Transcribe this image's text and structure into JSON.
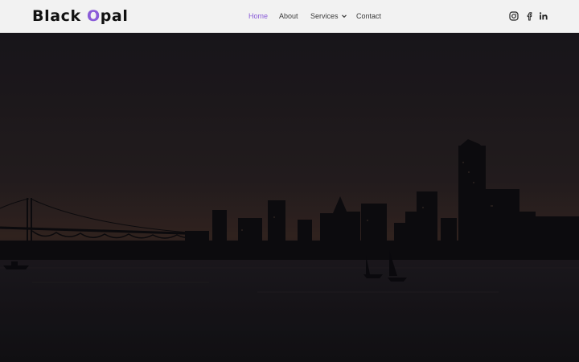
{
  "brand": {
    "name_prefix": "Black ",
    "name_accent": "O",
    "name_suffix": "pal",
    "accent_color": "#8a5cd8"
  },
  "nav": {
    "items": [
      {
        "label": "Home",
        "active": true
      },
      {
        "label": "About",
        "active": false
      },
      {
        "label": "Services",
        "active": false,
        "has_dropdown": true
      },
      {
        "label": "Contact",
        "active": false
      }
    ]
  },
  "social": {
    "icons": [
      "instagram-icon",
      "facebook-icon",
      "linkedin-icon"
    ]
  },
  "hero": {
    "image": "dark-overlay city skyline at dusk over water with bridge and sailboats",
    "colors": {
      "sky_top": "#1f1c22",
      "sky_horizon": "#3a2a25",
      "water": "#17161b"
    }
  }
}
